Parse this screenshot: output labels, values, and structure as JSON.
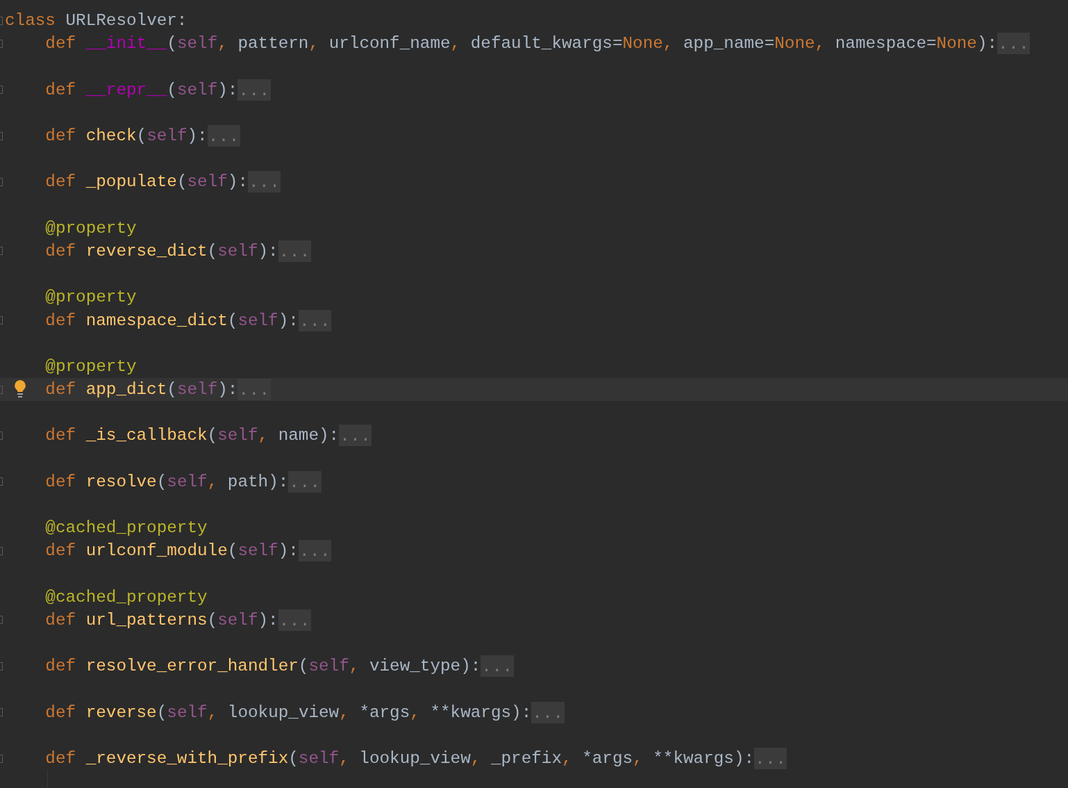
{
  "editor": {
    "lines": [
      {
        "kind": "code",
        "fold_marker": true,
        "current": false,
        "bulb": false,
        "tokens": [
          {
            "kind": "kw",
            "text": "class "
          },
          {
            "kind": "plain",
            "text": "URLResolver:"
          }
        ],
        "children": [
          {
            "kind": "code",
            "fold_marker": true,
            "current": false,
            "bulb": false,
            "tokens": [
              {
                "kind": "kw",
                "text": "def "
              },
              {
                "kind": "magic",
                "text": "__init__"
              },
              {
                "kind": "plain",
                "text": "("
              },
              {
                "kind": "self",
                "text": "self"
              },
              {
                "kind": "comma",
                "text": ", "
              },
              {
                "kind": "plain",
                "text": "pattern"
              },
              {
                "kind": "comma",
                "text": ", "
              },
              {
                "kind": "plain",
                "text": "urlconf_name"
              },
              {
                "kind": "comma",
                "text": ", "
              },
              {
                "kind": "plain",
                "text": "default_kwargs="
              },
              {
                "kind": "kw",
                "text": "None"
              },
              {
                "kind": "comma",
                "text": ", "
              },
              {
                "kind": "plain",
                "text": "app_name="
              },
              {
                "kind": "kw",
                "text": "None"
              },
              {
                "kind": "comma",
                "text": ", "
              },
              {
                "kind": "plain",
                "text": "namespace="
              },
              {
                "kind": "kw",
                "text": "None"
              },
              {
                "kind": "plain",
                "text": "):"
              }
            ],
            "folded": "..."
          },
          {
            "kind": "blank"
          },
          {
            "kind": "code",
            "fold_marker": true,
            "current": false,
            "bulb": false,
            "tokens": [
              {
                "kind": "kw",
                "text": "def "
              },
              {
                "kind": "magic",
                "text": "__repr__"
              },
              {
                "kind": "plain",
                "text": "("
              },
              {
                "kind": "self",
                "text": "self"
              },
              {
                "kind": "plain",
                "text": "):"
              }
            ],
            "folded": "..."
          },
          {
            "kind": "blank"
          },
          {
            "kind": "code",
            "fold_marker": true,
            "current": false,
            "bulb": false,
            "tokens": [
              {
                "kind": "kw",
                "text": "def "
              },
              {
                "kind": "fn",
                "text": "check"
              },
              {
                "kind": "plain",
                "text": "("
              },
              {
                "kind": "self",
                "text": "self"
              },
              {
                "kind": "plain",
                "text": "):"
              }
            ],
            "folded": "..."
          },
          {
            "kind": "blank"
          },
          {
            "kind": "code",
            "fold_marker": true,
            "current": false,
            "bulb": false,
            "tokens": [
              {
                "kind": "kw",
                "text": "def "
              },
              {
                "kind": "fn",
                "text": "_populate"
              },
              {
                "kind": "plain",
                "text": "("
              },
              {
                "kind": "self",
                "text": "self"
              },
              {
                "kind": "plain",
                "text": "):"
              }
            ],
            "folded": "..."
          },
          {
            "kind": "blank"
          },
          {
            "kind": "code",
            "fold_marker": false,
            "current": false,
            "bulb": false,
            "tokens": [
              {
                "kind": "deco",
                "text": "@property"
              }
            ]
          },
          {
            "kind": "code",
            "fold_marker": true,
            "current": false,
            "bulb": false,
            "tokens": [
              {
                "kind": "kw",
                "text": "def "
              },
              {
                "kind": "fn",
                "text": "reverse_dict"
              },
              {
                "kind": "plain",
                "text": "("
              },
              {
                "kind": "self",
                "text": "self"
              },
              {
                "kind": "plain",
                "text": "):"
              }
            ],
            "folded": "..."
          },
          {
            "kind": "blank"
          },
          {
            "kind": "code",
            "fold_marker": false,
            "current": false,
            "bulb": false,
            "tokens": [
              {
                "kind": "deco",
                "text": "@property"
              }
            ]
          },
          {
            "kind": "code",
            "fold_marker": true,
            "current": false,
            "bulb": false,
            "tokens": [
              {
                "kind": "kw",
                "text": "def "
              },
              {
                "kind": "fn",
                "text": "namespace_dict"
              },
              {
                "kind": "plain",
                "text": "("
              },
              {
                "kind": "self",
                "text": "self"
              },
              {
                "kind": "plain",
                "text": "):"
              }
            ],
            "folded": "..."
          },
          {
            "kind": "blank"
          },
          {
            "kind": "code",
            "fold_marker": false,
            "current": false,
            "bulb": false,
            "tokens": [
              {
                "kind": "deco",
                "text": "@property"
              }
            ]
          },
          {
            "kind": "code",
            "fold_marker": true,
            "current": true,
            "bulb": true,
            "tokens": [
              {
                "kind": "kw",
                "text": "def "
              },
              {
                "kind": "fn",
                "text": "app_dict"
              },
              {
                "kind": "plain",
                "text": "("
              },
              {
                "kind": "self",
                "text": "self"
              },
              {
                "kind": "plain",
                "text": "):"
              }
            ],
            "folded": "..."
          },
          {
            "kind": "blank"
          },
          {
            "kind": "code",
            "fold_marker": true,
            "current": false,
            "bulb": false,
            "tokens": [
              {
                "kind": "kw",
                "text": "def "
              },
              {
                "kind": "fn",
                "text": "_is_callback"
              },
              {
                "kind": "plain",
                "text": "("
              },
              {
                "kind": "self",
                "text": "self"
              },
              {
                "kind": "comma",
                "text": ", "
              },
              {
                "kind": "plain",
                "text": "name):"
              }
            ],
            "folded": "..."
          },
          {
            "kind": "blank"
          },
          {
            "kind": "code",
            "fold_marker": true,
            "current": false,
            "bulb": false,
            "tokens": [
              {
                "kind": "kw",
                "text": "def "
              },
              {
                "kind": "fn",
                "text": "resolve"
              },
              {
                "kind": "plain",
                "text": "("
              },
              {
                "kind": "self",
                "text": "self"
              },
              {
                "kind": "comma",
                "text": ", "
              },
              {
                "kind": "plain",
                "text": "path):"
              }
            ],
            "folded": "..."
          },
          {
            "kind": "blank"
          },
          {
            "kind": "code",
            "fold_marker": false,
            "current": false,
            "bulb": false,
            "tokens": [
              {
                "kind": "deco",
                "text": "@cached_property"
              }
            ]
          },
          {
            "kind": "code",
            "fold_marker": true,
            "current": false,
            "bulb": false,
            "tokens": [
              {
                "kind": "kw",
                "text": "def "
              },
              {
                "kind": "fn",
                "text": "urlconf_module"
              },
              {
                "kind": "plain",
                "text": "("
              },
              {
                "kind": "self",
                "text": "self"
              },
              {
                "kind": "plain",
                "text": "):"
              }
            ],
            "folded": "..."
          },
          {
            "kind": "blank"
          },
          {
            "kind": "code",
            "fold_marker": false,
            "current": false,
            "bulb": false,
            "tokens": [
              {
                "kind": "deco",
                "text": "@cached_property"
              }
            ]
          },
          {
            "kind": "code",
            "fold_marker": true,
            "current": false,
            "bulb": false,
            "tokens": [
              {
                "kind": "kw",
                "text": "def "
              },
              {
                "kind": "fn",
                "text": "url_patterns"
              },
              {
                "kind": "plain",
                "text": "("
              },
              {
                "kind": "self",
                "text": "self"
              },
              {
                "kind": "plain",
                "text": "):"
              }
            ],
            "folded": "..."
          },
          {
            "kind": "blank"
          },
          {
            "kind": "code",
            "fold_marker": true,
            "current": false,
            "bulb": false,
            "tokens": [
              {
                "kind": "kw",
                "text": "def "
              },
              {
                "kind": "fn",
                "text": "resolve_error_handler"
              },
              {
                "kind": "plain",
                "text": "("
              },
              {
                "kind": "self",
                "text": "self"
              },
              {
                "kind": "comma",
                "text": ", "
              },
              {
                "kind": "plain",
                "text": "view_type):"
              }
            ],
            "folded": "..."
          },
          {
            "kind": "blank"
          },
          {
            "kind": "code",
            "fold_marker": true,
            "current": false,
            "bulb": false,
            "tokens": [
              {
                "kind": "kw",
                "text": "def "
              },
              {
                "kind": "fn",
                "text": "reverse"
              },
              {
                "kind": "plain",
                "text": "("
              },
              {
                "kind": "self",
                "text": "self"
              },
              {
                "kind": "comma",
                "text": ", "
              },
              {
                "kind": "plain",
                "text": "lookup_view"
              },
              {
                "kind": "comma",
                "text": ", "
              },
              {
                "kind": "plain",
                "text": "*args"
              },
              {
                "kind": "comma",
                "text": ", "
              },
              {
                "kind": "plain",
                "text": "**kwargs):"
              }
            ],
            "folded": "..."
          },
          {
            "kind": "blank"
          },
          {
            "kind": "code",
            "fold_marker": true,
            "current": false,
            "bulb": false,
            "tokens": [
              {
                "kind": "kw",
                "text": "def "
              },
              {
                "kind": "fn",
                "text": "_reverse_with_prefix"
              },
              {
                "kind": "plain",
                "text": "("
              },
              {
                "kind": "self",
                "text": "self"
              },
              {
                "kind": "comma",
                "text": ", "
              },
              {
                "kind": "plain",
                "text": "lookup_view"
              },
              {
                "kind": "comma",
                "text": ", "
              },
              {
                "kind": "plain",
                "text": "_prefix"
              },
              {
                "kind": "comma",
                "text": ", "
              },
              {
                "kind": "plain",
                "text": "*args"
              },
              {
                "kind": "comma",
                "text": ", "
              },
              {
                "kind": "plain",
                "text": "**kwargs):"
              }
            ],
            "folded": "..."
          }
        ]
      }
    ]
  }
}
